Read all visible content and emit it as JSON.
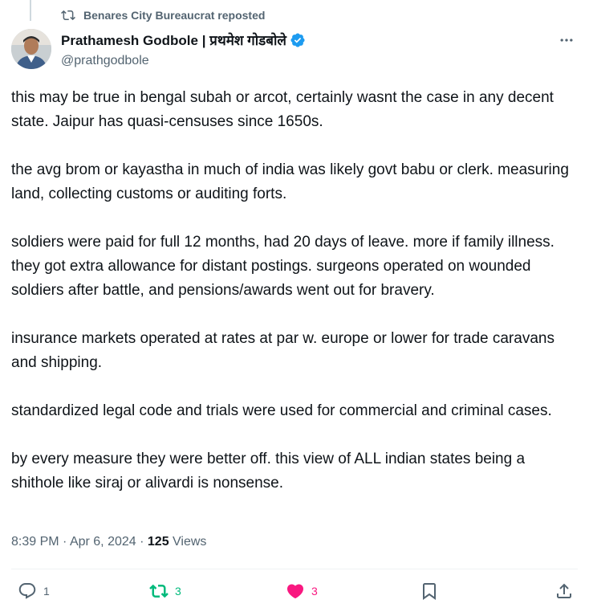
{
  "repost": {
    "label": "Benares City Bureaucrat reposted",
    "icon": "repost-icon"
  },
  "author": {
    "name": "Prathamesh Godbole | प्रथमेश गोडबोले",
    "handle": "@prathgodbole",
    "verified": true,
    "verified_color": "#1d9bf0"
  },
  "tweet": {
    "paragraphs": [
      "this may be true in bengal subah or arcot, certainly wasnt the case in any decent state. Jaipur has quasi-censuses since 1650s.",
      "the avg brom or kayastha in much of india was likely govt babu or clerk. measuring land, collecting customs or auditing forts.",
      "soldiers were paid for full 12 months, had 20 days of leave. more if family illness. they got extra allowance for distant postings. surgeons operated on wounded soldiers after battle, and pensions/awards went out for bravery.",
      "insurance markets operated at rates at par w. europe or lower for trade caravans and shipping.",
      "standardized legal code and trials were used for commercial and criminal cases.",
      "by every measure they were better off. this view of ALL indian states being a shithole like siraj or alivardi is nonsense."
    ]
  },
  "meta": {
    "time": "8:39 PM",
    "sep": " · ",
    "date": "Apr 6, 2024",
    "views_count": "125",
    "views_label": " Views"
  },
  "actions": {
    "reply_count": "1",
    "repost_count": "3",
    "like_count": "3",
    "repost_color": "#00ba7c",
    "like_color": "#f91880"
  }
}
